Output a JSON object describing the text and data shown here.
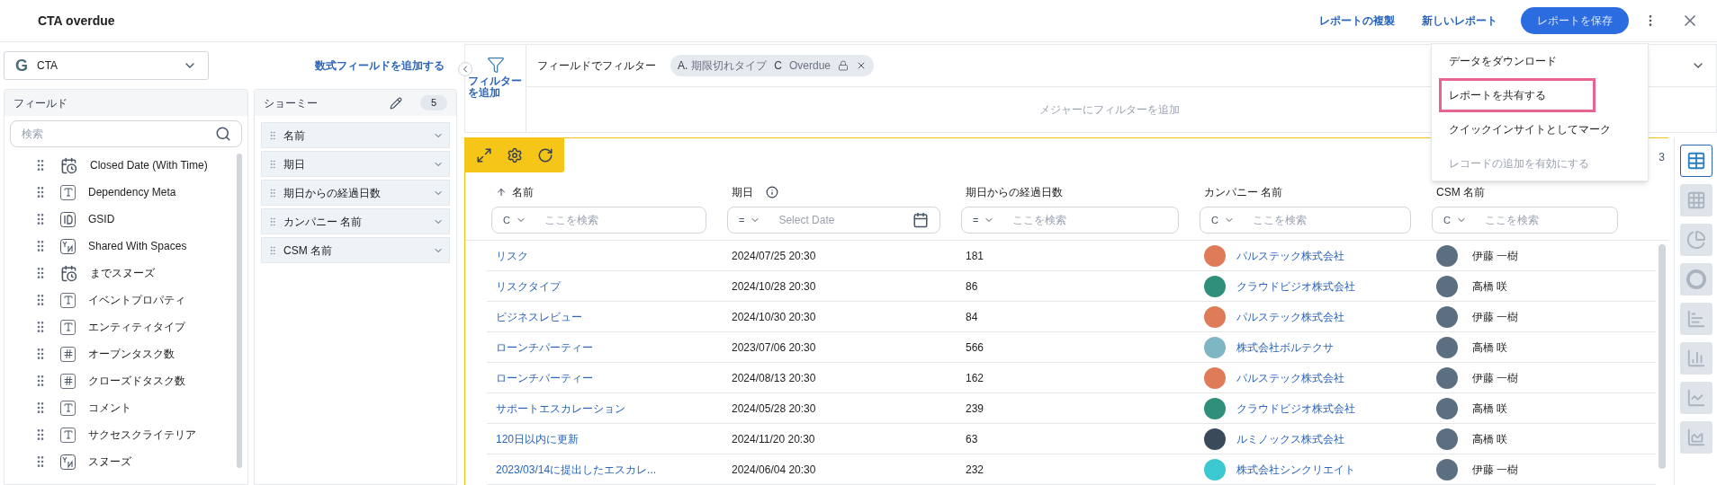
{
  "header": {
    "title": "CTA overdue",
    "actions": [
      "レポートの複製",
      "新しいレポート"
    ],
    "save": "レポートを保存"
  },
  "source": {
    "letter": "G",
    "value": "CTA"
  },
  "add_formula": "数式フィールドを追加する",
  "fields": {
    "title": "フィールド",
    "search_placeholder": "検索",
    "items": [
      {
        "kind": "date",
        "label": "Closed Date (With Time)"
      },
      {
        "kind": "text",
        "label": "Dependency Meta"
      },
      {
        "kind": "id",
        "label": "GSID"
      },
      {
        "kind": "yn",
        "label": "Shared With Spaces"
      },
      {
        "kind": "date",
        "label": "までスヌーズ"
      },
      {
        "kind": "text",
        "label": "イベントプロパティ"
      },
      {
        "kind": "text",
        "label": "エンティティタイプ"
      },
      {
        "kind": "number",
        "label": "オープンタスク数"
      },
      {
        "kind": "number",
        "label": "クローズドタスク数"
      },
      {
        "kind": "text",
        "label": "コメント"
      },
      {
        "kind": "text",
        "label": "サクセスクライテリア"
      },
      {
        "kind": "yn",
        "label": "スヌーズ"
      }
    ]
  },
  "show_me": {
    "title": "ショーミー",
    "count": "5",
    "items": [
      "名前",
      "期日",
      "期日からの経過日数",
      "カンパニー 名前",
      "CSM 名前"
    ]
  },
  "filters": {
    "add_label": "フィルターを追加",
    "by_field_label": "フィールドでフィルター",
    "chip": {
      "prefix": "A.",
      "field": "期限切れタイプ",
      "operator": "C",
      "value": "Overdue"
    },
    "measure_label": "メジャーにフィルターを追加"
  },
  "menu": {
    "items": [
      {
        "label": "データをダウンロード",
        "disabled": false,
        "highlighted": false
      },
      {
        "label": "レポートを共有する",
        "disabled": false,
        "highlighted": true
      },
      {
        "label": "クイックインサイトとしてマーク",
        "disabled": false,
        "highlighted": false
      },
      {
        "label": "レコードの追加を有効にする",
        "disabled": true,
        "highlighted": false
      }
    ]
  },
  "record_count": "3",
  "table": {
    "columns": [
      {
        "label": "名前",
        "sorted": true,
        "info": false,
        "filter": {
          "kind": "text",
          "operator": "C",
          "placeholder": "ここを検索"
        }
      },
      {
        "label": "期日",
        "sorted": false,
        "info": true,
        "filter": {
          "kind": "date",
          "operator": "=",
          "placeholder": "Select Date"
        }
      },
      {
        "label": "期日からの経過日数",
        "sorted": false,
        "info": false,
        "filter": {
          "kind": "text",
          "operator": "=",
          "placeholder": "ここを検索"
        }
      },
      {
        "label": "カンパニー 名前",
        "sorted": false,
        "info": false,
        "filter": {
          "kind": "text",
          "operator": "C",
          "placeholder": "ここを検索"
        }
      },
      {
        "label": "CSM 名前",
        "sorted": false,
        "info": false,
        "filter": {
          "kind": "text",
          "operator": "C",
          "placeholder": "ここを検索"
        }
      }
    ],
    "rows": [
      {
        "name": "リスク",
        "due": "2024/07/25 20:30",
        "days": "181",
        "company": {
          "name": "パルステック株式会社",
          "color": "#e07b5a"
        },
        "csm": "伊藤 一樹"
      },
      {
        "name": "リスクタイプ",
        "due": "2024/10/28 20:30",
        "days": "86",
        "company": {
          "name": "クラウドビジオ株式会社",
          "color": "#2f8f7a"
        },
        "csm": "高橋 咲"
      },
      {
        "name": "ビジネスレビュー",
        "due": "2024/10/30 20:30",
        "days": "84",
        "company": {
          "name": "パルステック株式会社",
          "color": "#e07b5a"
        },
        "csm": "伊藤 一樹"
      },
      {
        "name": "ローンチパーティー",
        "due": "2023/07/06 20:30",
        "days": "566",
        "company": {
          "name": "株式会社ボルテクサ",
          "color": "#7fb6c4"
        },
        "csm": "高橋 咲"
      },
      {
        "name": "ローンチパーティー",
        "due": "2024/08/13 20:30",
        "days": "162",
        "company": {
          "name": "パルステック株式会社",
          "color": "#e07b5a"
        },
        "csm": "伊藤 一樹"
      },
      {
        "name": "サポートエスカレーション",
        "due": "2024/05/28 20:30",
        "days": "239",
        "company": {
          "name": "クラウドビジオ株式会社",
          "color": "#2f8f7a"
        },
        "csm": "高橋 咲"
      },
      {
        "name": "120日以内に更新",
        "due": "2024/11/20 20:30",
        "days": "63",
        "company": {
          "name": "ルミノックス株式会社",
          "color": "#3b4a5a"
        },
        "csm": "高橋 咲"
      },
      {
        "name": "2023/03/14に提出したエスカレ...",
        "due": "2024/06/04 20:30",
        "days": "232",
        "company": {
          "name": "株式会社シンクリエイト",
          "color": "#3cc8d0"
        },
        "csm": "伊藤 一樹"
      }
    ]
  },
  "chart_types": [
    {
      "kind": "table",
      "selected": true
    },
    {
      "kind": "pivot",
      "selected": false
    },
    {
      "kind": "pie",
      "selected": false
    },
    {
      "kind": "donut",
      "selected": false
    },
    {
      "kind": "hbar",
      "selected": false
    },
    {
      "kind": "column",
      "selected": false
    },
    {
      "kind": "line",
      "selected": false
    },
    {
      "kind": "area",
      "selected": false
    }
  ]
}
